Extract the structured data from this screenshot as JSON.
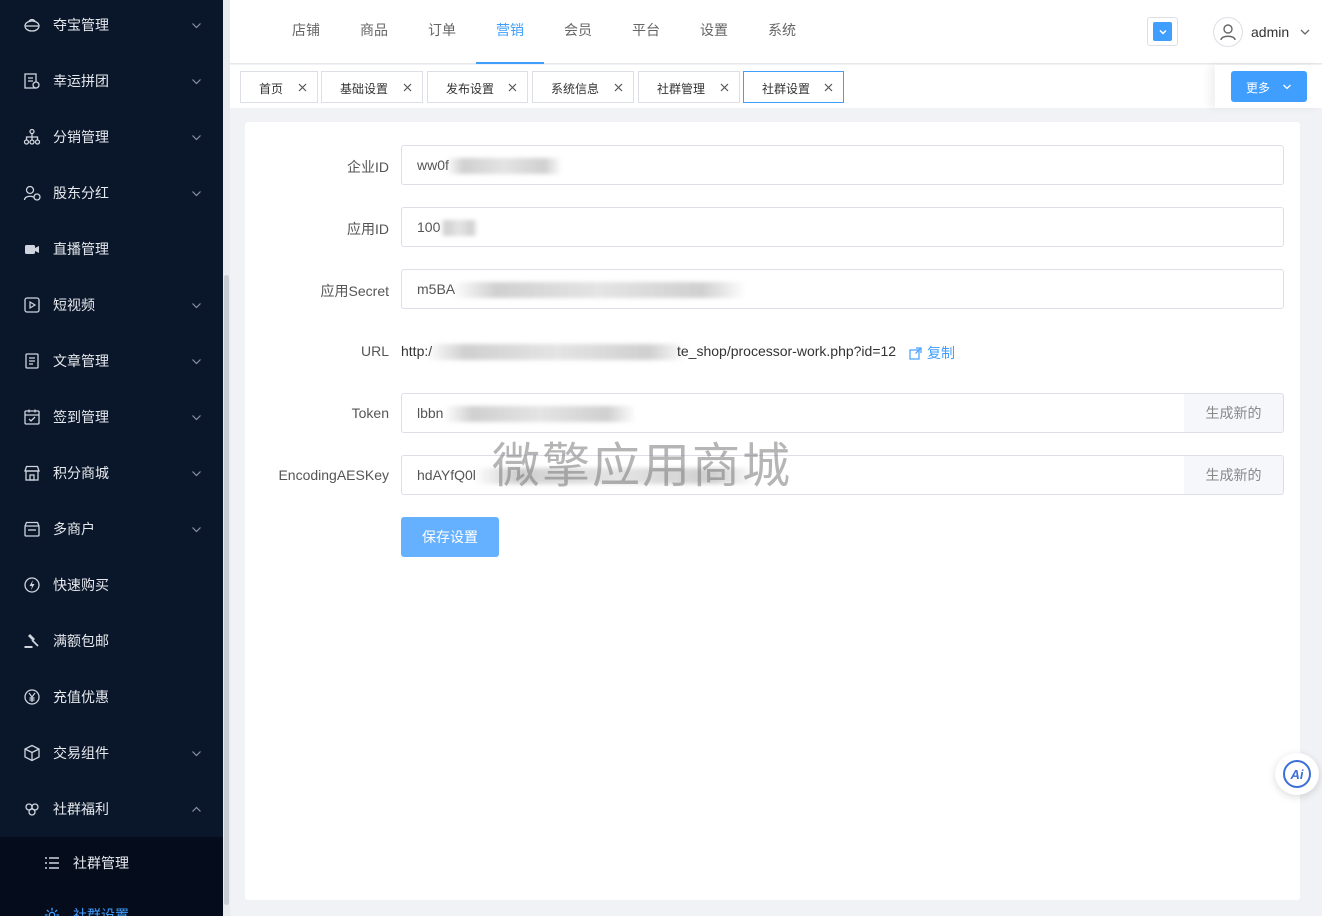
{
  "sidebar": {
    "items": [
      {
        "label": "夺宝管理",
        "icon": "treasure-icon",
        "chevron": "down"
      },
      {
        "label": "幸运拼团",
        "icon": "group-buy-icon",
        "chevron": "down"
      },
      {
        "label": "分销管理",
        "icon": "distribution-icon",
        "chevron": "down"
      },
      {
        "label": "股东分红",
        "icon": "shareholder-icon",
        "chevron": "down"
      },
      {
        "label": "直播管理",
        "icon": "live-camera-icon",
        "chevron": ""
      },
      {
        "label": "短视频",
        "icon": "video-play-icon",
        "chevron": "down"
      },
      {
        "label": "文章管理",
        "icon": "article-icon",
        "chevron": "down"
      },
      {
        "label": "签到管理",
        "icon": "calendar-check-icon",
        "chevron": "down"
      },
      {
        "label": "积分商城",
        "icon": "points-shop-icon",
        "chevron": "down"
      },
      {
        "label": "多商户",
        "icon": "merchant-icon",
        "chevron": "down"
      },
      {
        "label": "快速购买",
        "icon": "lightning-icon",
        "chevron": ""
      },
      {
        "label": "满额包邮",
        "icon": "gavel-icon",
        "chevron": ""
      },
      {
        "label": "充值优惠",
        "icon": "yen-icon",
        "chevron": ""
      },
      {
        "label": "交易组件",
        "icon": "cube-icon",
        "chevron": "down"
      },
      {
        "label": "社群福利",
        "icon": "community-icon",
        "chevron": "up"
      }
    ],
    "sub_items": [
      {
        "label": "社群管理",
        "icon": "list-icon"
      },
      {
        "label": "社群设置",
        "icon": "gear-icon"
      }
    ]
  },
  "topnav": {
    "tabs": [
      "店铺",
      "商品",
      "订单",
      "营销",
      "会员",
      "平台",
      "设置",
      "系统"
    ],
    "active_index": 3,
    "user": "admin"
  },
  "tabstrip": {
    "tags": [
      "首页",
      "基础设置",
      "发布设置",
      "系统信息",
      "社群管理",
      "社群设置"
    ],
    "active_index": 5,
    "more_label": "更多"
  },
  "form": {
    "corp_id": {
      "label": "企业ID",
      "value": "ww0f"
    },
    "app_id": {
      "label": "应用ID",
      "value": "100"
    },
    "app_secret": {
      "label": "应用Secret",
      "value": "m5BA"
    },
    "url": {
      "label": "URL",
      "value_start": "http:/",
      "value_end": "te_shop/processor-work.php?id=12",
      "copy_label": "复制"
    },
    "token": {
      "label": "Token",
      "value": "lbbn",
      "generate_label": "生成新的"
    },
    "aes_key": {
      "label": "EncodingAESKey",
      "value": "hdAYfQ0l",
      "generate_label": "生成新的"
    },
    "save_label": "保存设置"
  },
  "watermark": "微擎应用商城",
  "colors": {
    "sidebar_bg": "#0a1629",
    "accent": "#409eff",
    "save_button": "#66b1ff"
  }
}
